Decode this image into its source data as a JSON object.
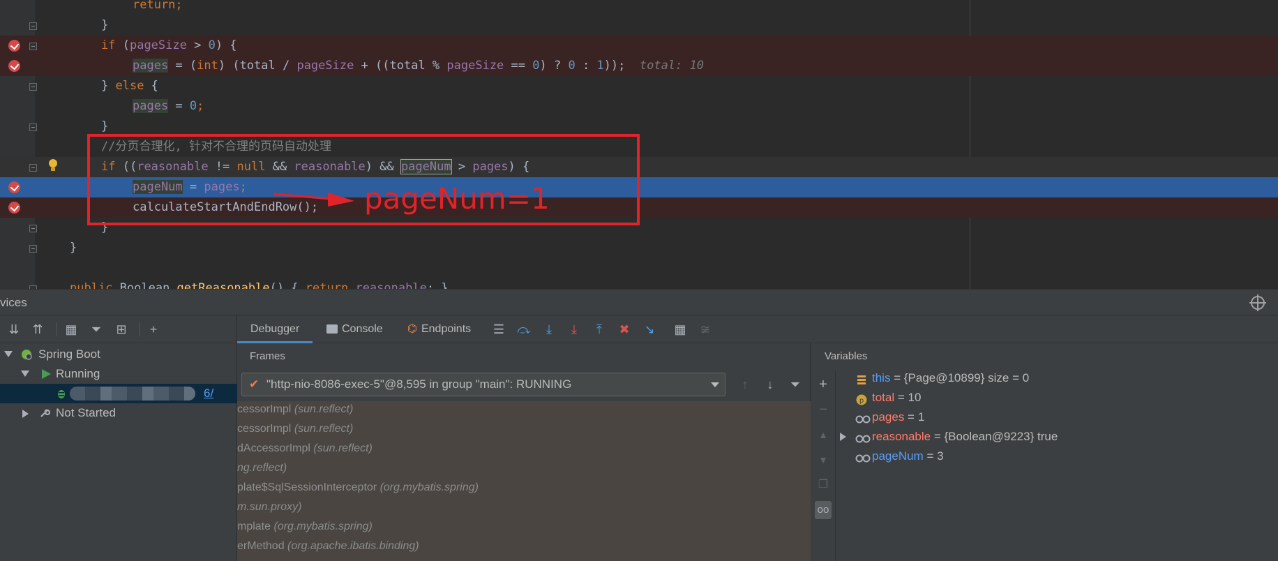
{
  "editor": {
    "lines": [
      {
        "id": "return",
        "tokens": [
          {
            "t": "return;",
            "c": "k"
          }
        ]
      },
      {
        "id": "close1",
        "tokens": [
          {
            "t": "}",
            "c": "p"
          }
        ]
      },
      {
        "id": "if-pagesize",
        "tokens": [
          {
            "t": "if ",
            "c": "k"
          },
          {
            "t": "(",
            "c": "p"
          },
          {
            "t": "pageSize",
            "c": "f"
          },
          {
            "t": " > ",
            "c": "p"
          },
          {
            "t": "0",
            "c": "n"
          },
          {
            "t": ") {",
            "c": "p"
          }
        ]
      },
      {
        "id": "pages-calc",
        "tokens": [
          {
            "t": "pages",
            "c": "f hl"
          },
          {
            "t": " = (",
            "c": "p"
          },
          {
            "t": "int",
            "c": "k"
          },
          {
            "t": ") (total / ",
            "c": "p"
          },
          {
            "t": "pageSize",
            "c": "f"
          },
          {
            "t": " + ((total % ",
            "c": "p"
          },
          {
            "t": "pageSize",
            "c": "f"
          },
          {
            "t": " == ",
            "c": "p"
          },
          {
            "t": "0",
            "c": "n"
          },
          {
            "t": ") ? ",
            "c": "p"
          },
          {
            "t": "0",
            "c": "n"
          },
          {
            "t": " : ",
            "c": "p"
          },
          {
            "t": "1",
            "c": "n"
          },
          {
            "t": "));",
            "c": "p"
          },
          {
            "t": "  total: 10",
            "c": "hint"
          }
        ]
      },
      {
        "id": "else",
        "tokens": [
          {
            "t": "} ",
            "c": "p"
          },
          {
            "t": "else",
            "c": "k"
          },
          {
            "t": " {",
            "c": "p"
          }
        ]
      },
      {
        "id": "pages-zero",
        "tokens": [
          {
            "t": "pages",
            "c": "f hl"
          },
          {
            "t": " = ",
            "c": "p"
          },
          {
            "t": "0",
            "c": "n"
          },
          {
            "t": ";",
            "c": "k"
          }
        ]
      },
      {
        "id": "close2",
        "tokens": [
          {
            "t": "}",
            "c": "p"
          }
        ]
      },
      {
        "id": "comment",
        "tokens": [
          {
            "t": "//分页合理化, 针对不合理的页码自动处理",
            "c": "cm"
          }
        ]
      },
      {
        "id": "if-reasonable",
        "tokens": [
          {
            "t": "if ",
            "c": "k"
          },
          {
            "t": "((",
            "c": "p"
          },
          {
            "t": "reasonable",
            "c": "f"
          },
          {
            "t": " != ",
            "c": "p"
          },
          {
            "t": "null",
            "c": "k"
          },
          {
            "t": " && ",
            "c": "p"
          },
          {
            "t": "reasonable",
            "c": "f"
          },
          {
            "t": ") && ",
            "c": "p"
          },
          {
            "t": "pageNum",
            "c": "f hlbox"
          },
          {
            "t": " > ",
            "c": "p"
          },
          {
            "t": "pages",
            "c": "f"
          },
          {
            "t": ") {",
            "c": "p"
          }
        ]
      },
      {
        "id": "pagenum-assign",
        "tokens": [
          {
            "t": "pageNum",
            "c": "f hl"
          },
          {
            "t": " = ",
            "c": "p"
          },
          {
            "t": "pages",
            "c": "f"
          },
          {
            "t": ";",
            "c": "k"
          }
        ]
      },
      {
        "id": "calc-rows",
        "tokens": [
          {
            "t": "calculateStartAndEndRow();",
            "c": "p"
          }
        ]
      },
      {
        "id": "close3",
        "tokens": [
          {
            "t": "}",
            "c": "p"
          }
        ]
      },
      {
        "id": "close4",
        "tokens": [
          {
            "t": "}",
            "c": "p"
          }
        ]
      },
      {
        "id": "blank",
        "tokens": []
      },
      {
        "id": "getter",
        "tokens": [
          {
            "t": "public ",
            "c": "k"
          },
          {
            "t": "Boolean ",
            "c": "p"
          },
          {
            "t": "getReasonable",
            "c": "m"
          },
          {
            "t": "() { ",
            "c": "p"
          },
          {
            "t": "return ",
            "c": "k"
          },
          {
            "t": "reasonable",
            "c": "f"
          },
          {
            "t": "; }",
            "c": "p"
          }
        ]
      }
    ],
    "annotation": "pageNum=1"
  },
  "services": {
    "title": "vices",
    "tree": {
      "spring_boot": "Spring Boot",
      "running": "Running",
      "app_port": "6/",
      "not_started": "Not Started"
    }
  },
  "debugger": {
    "tabs": {
      "debugger": "Debugger",
      "console": "Console",
      "endpoints": "Endpoints"
    },
    "frames": {
      "title": "Frames",
      "thread": "\"http-nio-8086-exec-5\"@8,595 in group \"main\": RUNNING",
      "rows": [
        {
          "method": "cessorImpl",
          "cls": "(sun.reflect)"
        },
        {
          "method": "cessorImpl",
          "cls": "(sun.reflect)"
        },
        {
          "method": "dAccessorImpl",
          "cls": "(sun.reflect)"
        },
        {
          "method": "",
          "cls": "ng.reflect)"
        },
        {
          "method": "plate$SqlSessionInterceptor",
          "cls": "(org.mybatis.spring)"
        },
        {
          "method": "",
          "cls": "m.sun.proxy)"
        },
        {
          "method": "mplate",
          "cls": "(org.mybatis.spring)"
        },
        {
          "method": "erMethod",
          "cls": "(org.apache.ibatis.binding)"
        }
      ]
    },
    "variables": {
      "title": "Variables",
      "items": [
        {
          "name": "this",
          "name_color": "#589df6",
          "icon": "field-list-icon",
          "value": " = {Page@10899}  size = 0",
          "expandable": false
        },
        {
          "name": "total",
          "name_color": "#ff7a6c",
          "icon": "parameter-icon",
          "value": " = 10",
          "expandable": false
        },
        {
          "name": "pages",
          "name_color": "#ff7a6c",
          "icon": "watch-glasses-icon",
          "value": " = 1",
          "expandable": false
        },
        {
          "name": "reasonable",
          "name_color": "#ff7a6c",
          "icon": "watch-glasses-icon",
          "value": " = {Boolean@9223} true",
          "expandable": true
        },
        {
          "name": "pageNum",
          "name_color": "#589df6",
          "icon": "watch-glasses-icon",
          "value": " = 3",
          "expandable": false
        }
      ]
    }
  }
}
